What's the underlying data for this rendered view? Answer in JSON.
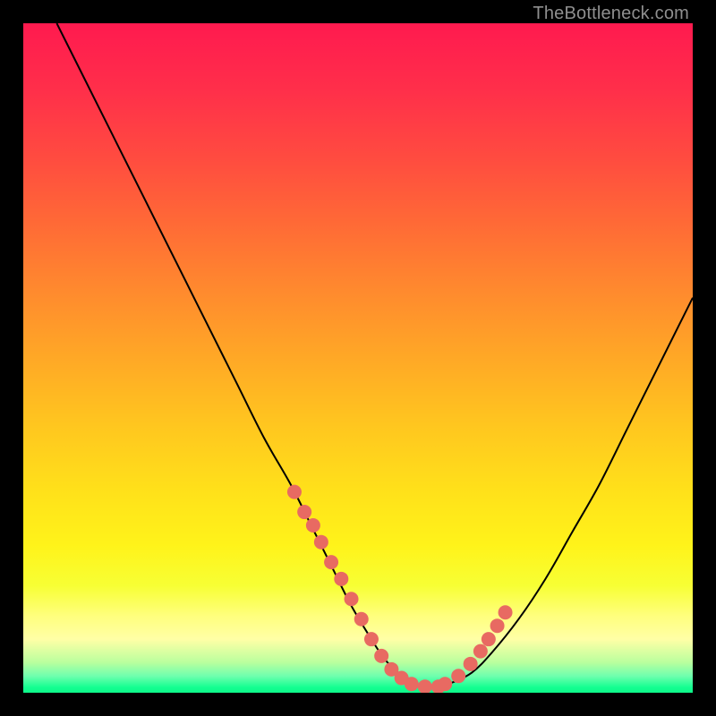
{
  "watermark": "TheBottleneck.com",
  "colors": {
    "bg": "#000000",
    "gradient_stops": [
      {
        "offset": 0.0,
        "color": "#ff1a4f"
      },
      {
        "offset": 0.1,
        "color": "#ff2f4a"
      },
      {
        "offset": 0.2,
        "color": "#ff4b40"
      },
      {
        "offset": 0.3,
        "color": "#ff6a36"
      },
      {
        "offset": 0.4,
        "color": "#ff8a2e"
      },
      {
        "offset": 0.5,
        "color": "#ffa826"
      },
      {
        "offset": 0.6,
        "color": "#ffc61f"
      },
      {
        "offset": 0.7,
        "color": "#ffe11a"
      },
      {
        "offset": 0.78,
        "color": "#fff31a"
      },
      {
        "offset": 0.84,
        "color": "#f7ff34"
      },
      {
        "offset": 0.885,
        "color": "#ffff7d"
      },
      {
        "offset": 0.92,
        "color": "#ffffa6"
      },
      {
        "offset": 0.955,
        "color": "#b9ff9e"
      },
      {
        "offset": 0.975,
        "color": "#6fffae"
      },
      {
        "offset": 0.992,
        "color": "#14ff91"
      },
      {
        "offset": 1.0,
        "color": "#0ef789"
      }
    ],
    "curve": "#000000",
    "marker_fill": "#e86a62",
    "marker_stroke": "#e86a62"
  },
  "chart_data": {
    "type": "line",
    "title": "",
    "xlabel": "",
    "ylabel": "",
    "xlim": [
      0,
      100
    ],
    "ylim": [
      0,
      100
    ],
    "series": [
      {
        "name": "bottleneck-curve",
        "x": [
          5,
          8,
          12,
          16,
          20,
          24,
          28,
          32,
          36,
          40,
          43,
          46,
          49,
          52,
          54,
          56,
          58,
          60,
          62,
          64,
          67,
          70,
          74,
          78,
          82,
          86,
          90,
          94,
          98,
          100
        ],
        "y": [
          100,
          94,
          86,
          78,
          70,
          62,
          54,
          46,
          38,
          31,
          25,
          19,
          13,
          8,
          5,
          3,
          1.5,
          1,
          1,
          1.5,
          3,
          6,
          11,
          17,
          24,
          31,
          39,
          47,
          55,
          59
        ]
      }
    ],
    "markers": {
      "name": "highlight-dots",
      "x": [
        40.5,
        42,
        43.3,
        44.5,
        46,
        47.5,
        49,
        50.5,
        52,
        53.5,
        55,
        56.5,
        58,
        60,
        62,
        63,
        65,
        66.8,
        68.3,
        69.5,
        70.8,
        72
      ],
      "y": [
        30,
        27,
        25,
        22.5,
        19.5,
        17,
        14,
        11,
        8,
        5.5,
        3.5,
        2.2,
        1.3,
        0.9,
        0.9,
        1.3,
        2.5,
        4.3,
        6.2,
        8,
        10,
        12
      ]
    }
  }
}
